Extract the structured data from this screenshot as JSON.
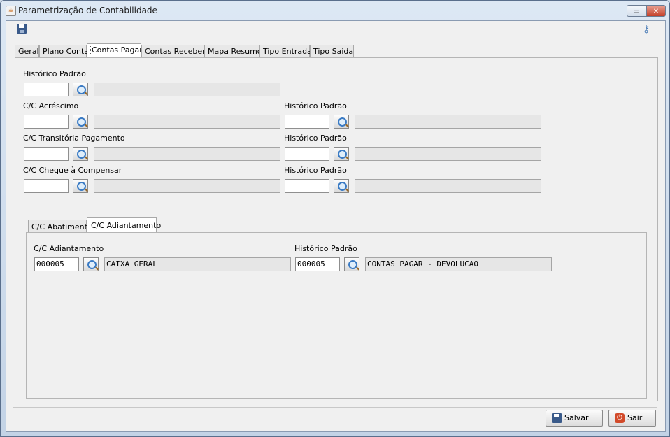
{
  "window": {
    "title": "Parametrização de Contabilidade",
    "restore_glyph": "▭",
    "close_glyph": "✕"
  },
  "toolbar": {
    "save_icon": "floppy-disk-icon",
    "key_icon": "key-icon",
    "key_glyph": "⚷"
  },
  "tabs": [
    {
      "label": "Geral"
    },
    {
      "label": "Plano Conta"
    },
    {
      "label": "Contas Pagar",
      "active": true
    },
    {
      "label": "Contas Receber"
    },
    {
      "label": "Mapa Resumo"
    },
    {
      "label": "Tipo Entrada"
    },
    {
      "label": "Tipo Saida"
    }
  ],
  "contas_pagar": {
    "historico_padrao": {
      "label": "Histórico Padrão",
      "code": "",
      "description": ""
    },
    "acrescimo": {
      "label": "C/C Acréscimo",
      "code": "",
      "description": "",
      "hist_label": "Histórico Padrão",
      "hist_code": "",
      "hist_description": ""
    },
    "transitoria": {
      "label": "C/C Transitória Pagamento",
      "code": "",
      "description": "",
      "hist_label": "Histórico Padrão",
      "hist_code": "",
      "hist_description": ""
    },
    "cheque": {
      "label": "C/C Cheque à Compensar",
      "code": "",
      "description": "",
      "hist_label": "Histórico Padrão",
      "hist_code": "",
      "hist_description": ""
    }
  },
  "subtabs": [
    {
      "label": "C/C Abatimento"
    },
    {
      "label": "C/C Adiantamento",
      "active": true
    }
  ],
  "adiantamento": {
    "label": "C/C Adiantamento",
    "code": "000005",
    "description": "CAIXA GERAL",
    "hist_label": "Histórico Padrão",
    "hist_code": "000005",
    "hist_description": "CONTAS PAGAR - DEVOLUCAO"
  },
  "buttons": {
    "save": "Salvar",
    "exit": "Sair",
    "exit_glyph": "⏻"
  },
  "colors": {
    "accent": "#3b7bc4",
    "close_red": "#c4402a"
  }
}
